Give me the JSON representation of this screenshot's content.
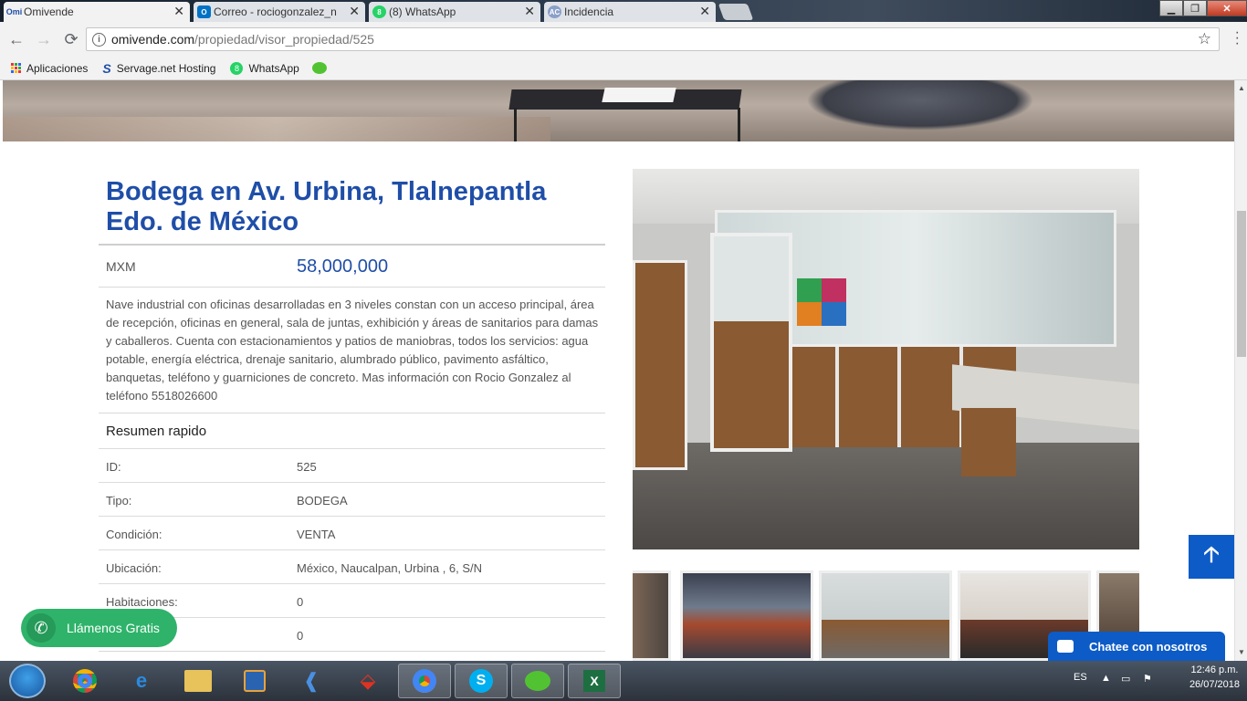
{
  "browser": {
    "tabs": [
      {
        "label": "Omivende",
        "favicon": "Omi",
        "color": "#1f4ea8"
      },
      {
        "label": "Correo - rociogonzalez_n",
        "favicon": "O",
        "color": "#0072c6"
      },
      {
        "label": "(8) WhatsApp",
        "favicon": "8",
        "color": "#25d366"
      },
      {
        "label": "Incidencia",
        "favicon": "AC",
        "color": "#8aa0c8"
      }
    ],
    "url_host": "omivende.com",
    "url_path": "/propiedad/visor_propiedad/525",
    "bookmarks": [
      {
        "label": "Aplicaciones",
        "icon": "apps-grid-icon"
      },
      {
        "label": "Servage.net Hosting",
        "icon": "servage-s-icon"
      },
      {
        "label": "WhatsApp",
        "icon": "whatsapp-badge-icon"
      }
    ]
  },
  "property": {
    "title": "Bodega en Av. Urbina, Tlalnepantla Edo. de México",
    "currency": "MXM",
    "price": "58,000,000",
    "description": "Nave industrial con oficinas desarrolladas en 3 niveles constan con un acceso principal, área de recepción, oficinas en general, sala de juntas, exhibición y áreas de sanitarios para damas y caballeros. Cuenta con estacionamientos y patios de maniobras, todos los servicios: agua potable, energía eléctrica, drenaje sanitario, alumbrado público, pavimento asfáltico, banquetas, teléfono y guarniciones de concreto. Mas información con Rocio Gonzalez al teléfono 5518026600",
    "summary_title": "Resumen rapido",
    "summary": [
      {
        "key": "ID:",
        "value": "525"
      },
      {
        "key": "Tipo:",
        "value": "BODEGA"
      },
      {
        "key": "Condición:",
        "value": "VENTA"
      },
      {
        "key": "Ubicación:",
        "value": "México, Naucalpan, Urbina , 6, S/N"
      },
      {
        "key": "Habitaciones:",
        "value": "0"
      },
      {
        "key": "",
        "value": "0"
      }
    ]
  },
  "widgets": {
    "call_label": "Llámenos Gratis",
    "chat_label": "Chatee con nosotros",
    "scroll_top_icon": "arrow-up-icon"
  },
  "taskbar": {
    "lang": "ES",
    "time": "12:46 p.m.",
    "date": "26/07/2018"
  }
}
